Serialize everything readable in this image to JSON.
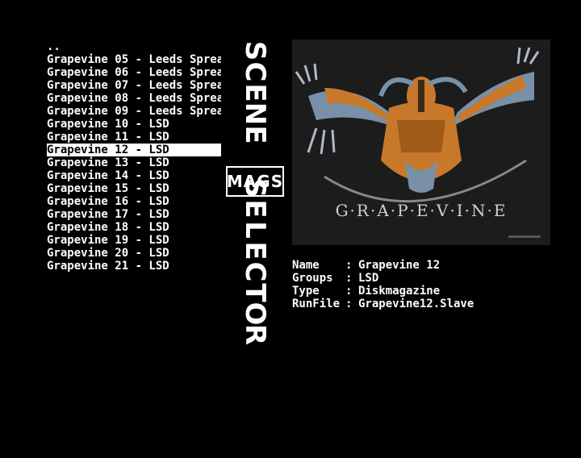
{
  "file_list": {
    "items": [
      {
        "label": "..",
        "selected": false
      },
      {
        "label": "Grapevine 05 - Leeds Sprea",
        "selected": false
      },
      {
        "label": "Grapevine 06 - Leeds Sprea",
        "selected": false
      },
      {
        "label": "Grapevine 07 - Leeds Sprea",
        "selected": false
      },
      {
        "label": "Grapevine 08 - Leeds Sprea",
        "selected": false
      },
      {
        "label": "Grapevine 09 - Leeds Sprea",
        "selected": false
      },
      {
        "label": "Grapevine 10 - LSD",
        "selected": false
      },
      {
        "label": "Grapevine 11 - LSD",
        "selected": false
      },
      {
        "label": "Grapevine 12 - LSD",
        "selected": true
      },
      {
        "label": "Grapevine 13 - LSD",
        "selected": false
      },
      {
        "label": "Grapevine 14 - LSD",
        "selected": false
      },
      {
        "label": "Grapevine 15 - LSD",
        "selected": false
      },
      {
        "label": "Grapevine 16 - LSD",
        "selected": false
      },
      {
        "label": "Grapevine 17 - LSD",
        "selected": false
      },
      {
        "label": "Grapevine 18 - LSD",
        "selected": false
      },
      {
        "label": "Grapevine 19 - LSD",
        "selected": false
      },
      {
        "label": "Grapevine 20 - LSD",
        "selected": false
      },
      {
        "label": "Grapevine 21 - LSD",
        "selected": false
      }
    ]
  },
  "banner": {
    "word_top": "SCENE",
    "word_bottom": "SELECTOR",
    "mags": "MAGS"
  },
  "preview": {
    "title": "G·R·A·P·E·V·I·N·E"
  },
  "info": {
    "name_label": "Name",
    "name_value": "Grapevine 12",
    "groups_label": "Groups",
    "groups_value": "LSD",
    "type_label": "Type",
    "type_value": "Diskmagazine",
    "runfile_label": "RunFile",
    "runfile_value": "Grapevine12.Slave",
    "separator": ":"
  },
  "colors": {
    "background": "#000000",
    "text": "#ffffff",
    "highlight": "#ffffff",
    "preview_bg": "#1c1c1c",
    "figure_orange": "#c8782a",
    "figure_blue": "#7890a8"
  }
}
